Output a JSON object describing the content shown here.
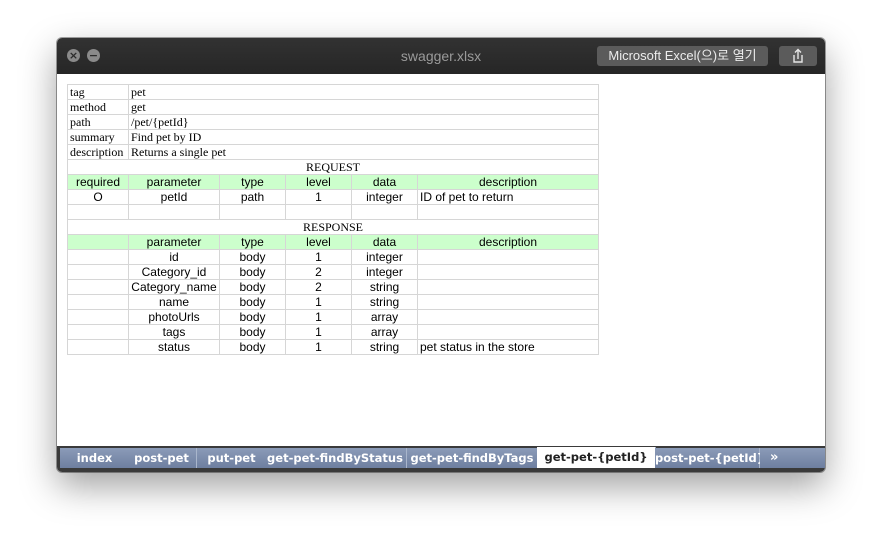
{
  "window": {
    "title": "swagger.xlsx",
    "open_button_label": "Microsoft Excel(으)로 열기",
    "close_icon": "close-icon",
    "minimize_icon": "minimize-icon",
    "share_icon": "share-icon"
  },
  "sheet": {
    "meta": [
      {
        "key": "tag",
        "value": "pet"
      },
      {
        "key": "method",
        "value": "get"
      },
      {
        "key": "path",
        "value": "/pet/{petId}"
      },
      {
        "key": "summary",
        "value": "Find pet by ID"
      },
      {
        "key": "description",
        "value": "Returns a single pet"
      }
    ],
    "request": {
      "title": "REQUEST",
      "headers": [
        "required",
        "parameter",
        "type",
        "level",
        "data",
        "description"
      ],
      "rows": [
        [
          "O",
          "petId",
          "path",
          "1",
          "integer",
          "ID of pet to return"
        ]
      ]
    },
    "response": {
      "title": "RESPONSE",
      "headers": [
        "",
        "parameter",
        "type",
        "level",
        "data",
        "description"
      ],
      "rows": [
        [
          "",
          "id",
          "body",
          "1",
          "integer",
          ""
        ],
        [
          "",
          "Category_id",
          "body",
          "2",
          "integer",
          ""
        ],
        [
          "",
          "Category_name",
          "body",
          "2",
          "string",
          ""
        ],
        [
          "",
          "name",
          "body",
          "1",
          "string",
          ""
        ],
        [
          "",
          "photoUrls",
          "body",
          "1",
          "array",
          ""
        ],
        [
          "",
          "tags",
          "body",
          "1",
          "array",
          ""
        ],
        [
          "",
          "status",
          "body",
          "1",
          "string",
          "pet status in the store"
        ]
      ]
    }
  },
  "tabs": [
    {
      "label": "index",
      "active": false
    },
    {
      "label": "post-pet",
      "active": false
    },
    {
      "label": "put-pet",
      "active": false
    },
    {
      "label": "get-pet-findByStatus",
      "active": false
    },
    {
      "label": "get-pet-findByTags",
      "active": false
    },
    {
      "label": "get-pet-{petId}",
      "active": true
    },
    {
      "label": "post-pet-{petId}",
      "active": false
    }
  ],
  "more_tabs_label": "»"
}
